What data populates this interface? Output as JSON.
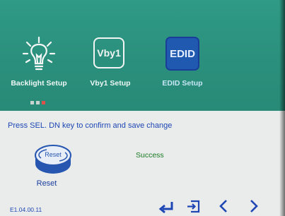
{
  "menu": {
    "items": [
      {
        "label": "Backlight Setup",
        "icon": "bulb-icon"
      },
      {
        "label": "Vby1 Setup",
        "icon_text": "Vby1"
      },
      {
        "label": "EDID Setup",
        "icon_text": "EDID",
        "selected": true
      }
    ]
  },
  "prompt": "Press SEL. DN key to confirm and save change",
  "reset": {
    "icon_text": "Reset",
    "label": "Reset"
  },
  "status": "Success",
  "version": "E1.04.00.11",
  "colors": {
    "teal": "#2f9a86",
    "blue_text": "#1e46b4",
    "success": "#197a22",
    "selected": "#1f5ab0"
  }
}
